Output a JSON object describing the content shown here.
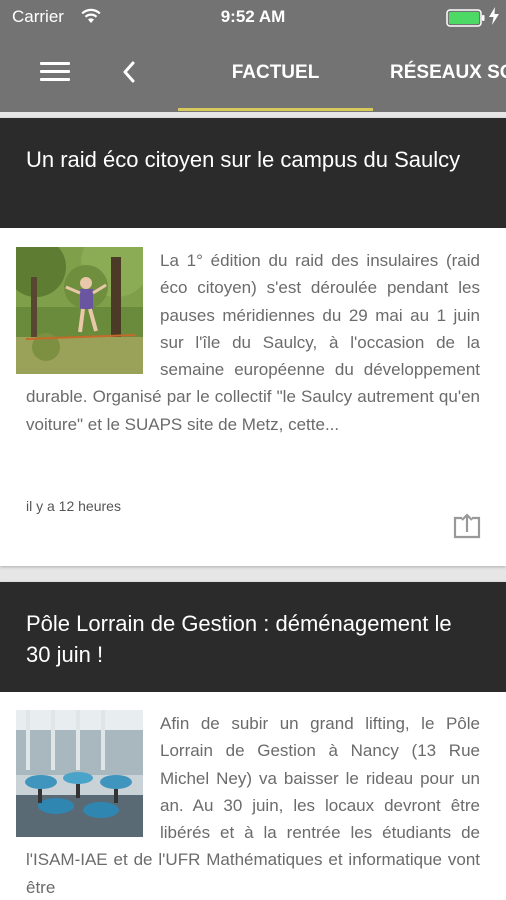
{
  "status": {
    "carrier": "Carrier",
    "time": "9:52 AM"
  },
  "nav": {
    "icons": {
      "menu": "hamburger-menu",
      "back": "chevron-left"
    },
    "tabs": [
      {
        "label": "FACTUEL",
        "active": true
      },
      {
        "label": "RÉSEAUX SO",
        "active": false
      }
    ]
  },
  "colors": {
    "bar": "#737373",
    "header": "#2b2b2b",
    "accent": "#d6cb5a",
    "battery": "#4cd964"
  },
  "articles": [
    {
      "title": "Un raid éco citoyen sur le campus du Saulcy",
      "excerpt": "La 1° édition du raid des insulaires (raid éco citoyen) s'est déroulée pendant les pauses méridiennes du 29 mai au 1 juin sur l'île du Saulcy, à l'occasion de la semaine européenne du développement durable. Organisé par le collectif \"le Saulcy autrement qu'en voiture\" et le SUAPS site de Metz, cette...",
      "time": "il y a 12 heures",
      "image": "photo-slackline-forest",
      "share_icon": "share-icon"
    },
    {
      "title": "Pôle Lorrain de Gestion : déménagement le 30 juin !",
      "excerpt": "Afin de subir un grand lifting, le Pôle Lorrain de Gestion à Nancy (13 Rue Michel Ney) va baisser le rideau pour un an. Au 30 juin, les locaux devront être libérés et à la rentrée les étudiants de l'ISAM-IAE et de l'UFR Mathématiques et informatique vont être",
      "image": "photo-classroom-chairs"
    }
  ]
}
